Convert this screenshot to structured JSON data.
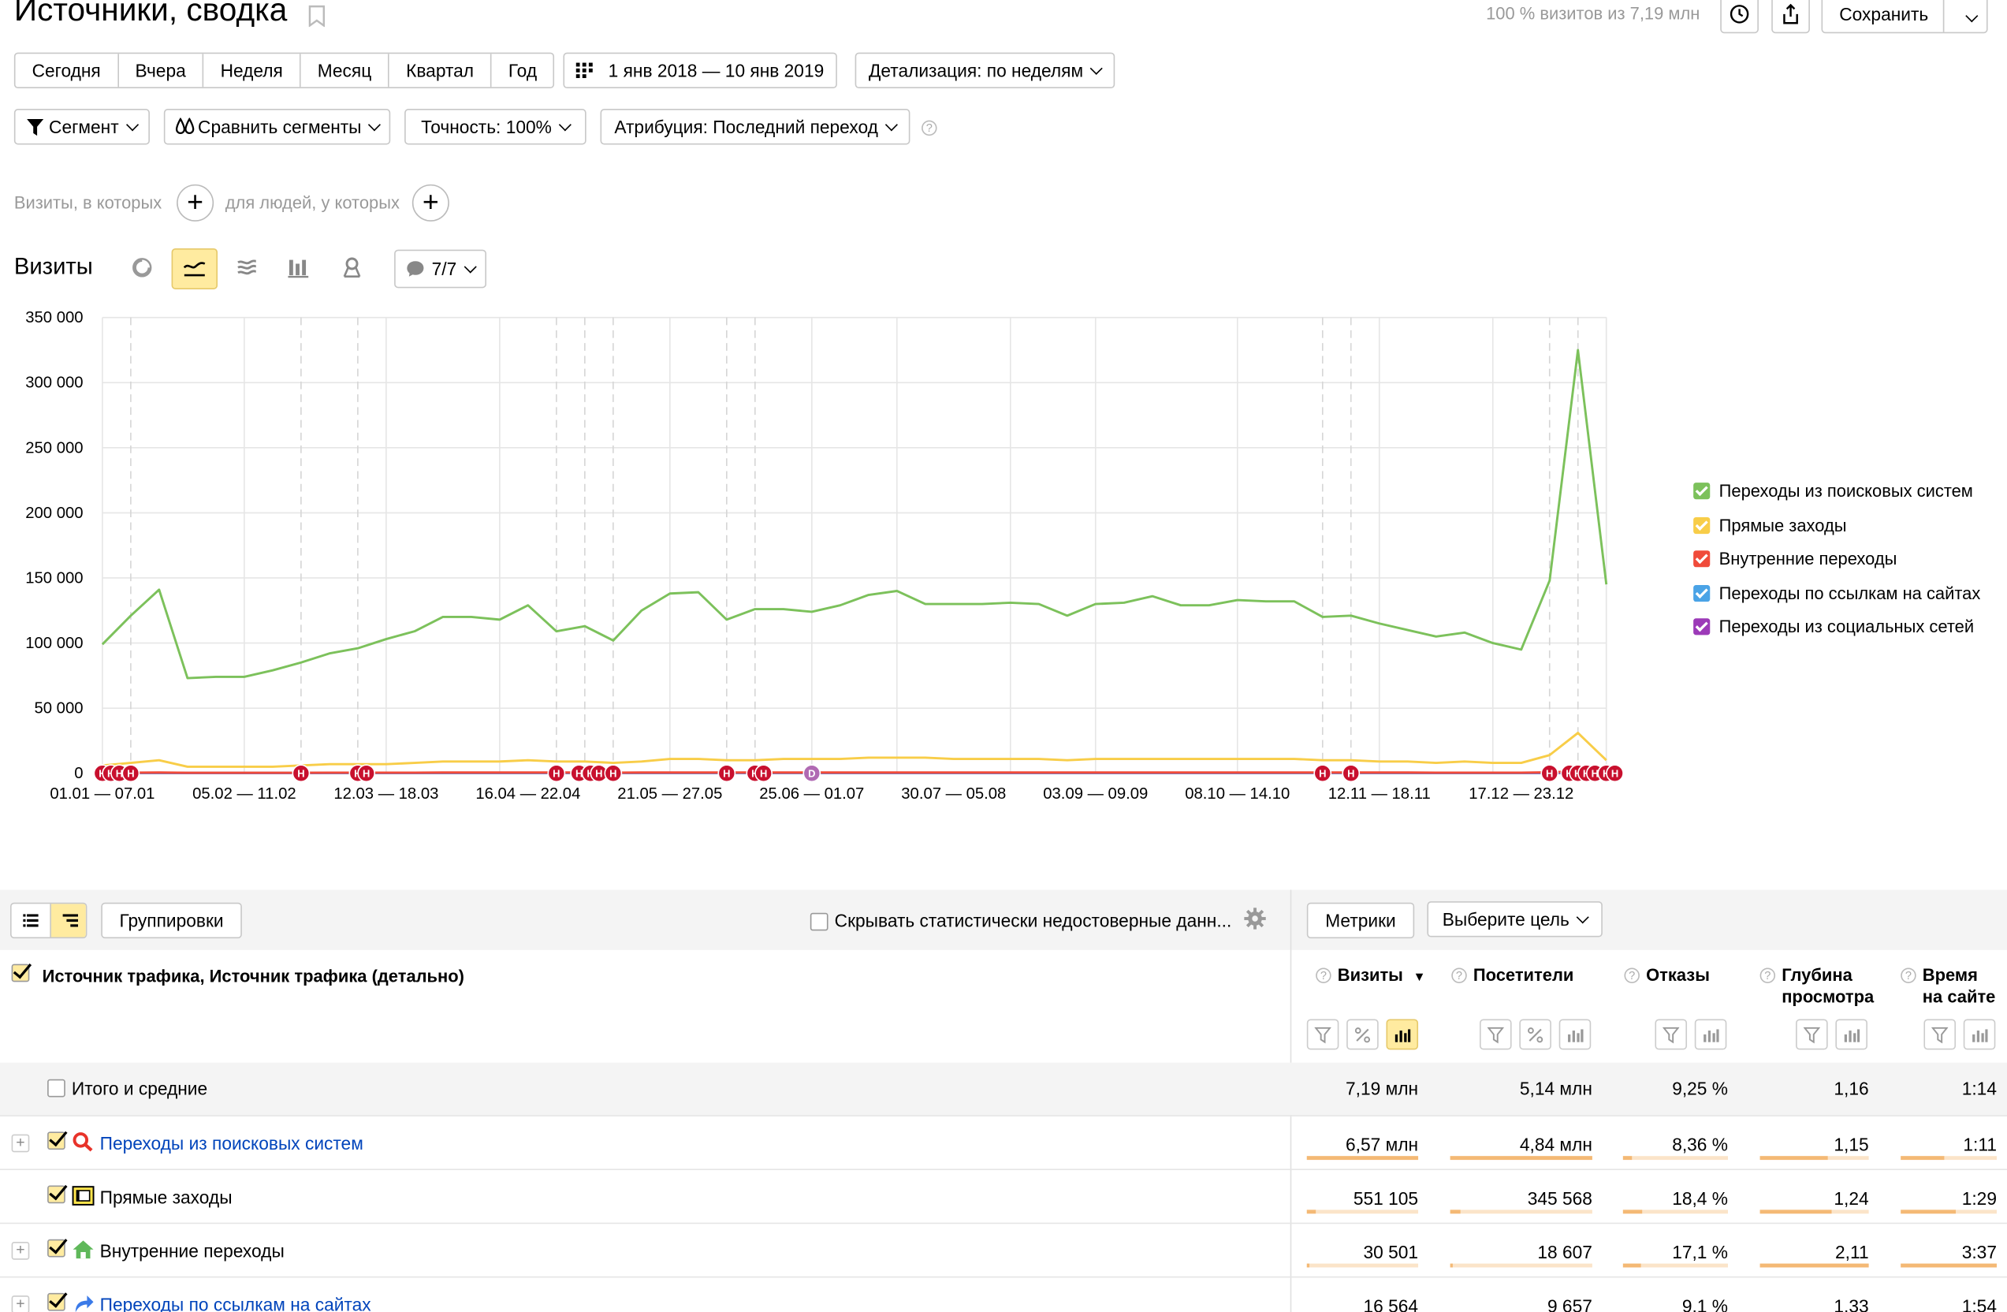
{
  "header": {
    "title": "Источники, сводка",
    "visits_info": "100 % визитов из 7,19 млн",
    "save_label": "Сохранить"
  },
  "periods": [
    "Сегодня",
    "Вчера",
    "Неделя",
    "Месяц",
    "Квартал",
    "Год"
  ],
  "date_range": "1 янв 2018 — 10 янв 2019",
  "detail": "Детализация: по неделям",
  "filters": {
    "segment": "Сегмент",
    "compare": "Сравнить сегменты",
    "accuracy": "Точность: 100%",
    "attribution": "Атрибуция: Последний переход"
  },
  "conditions": {
    "visits_label": "Визиты, в которых",
    "people_label": "для людей, у которых"
  },
  "chart_header": {
    "title": "Визиты",
    "notes_count": "7/7"
  },
  "chart_data": {
    "type": "line",
    "x_tick_labels": [
      "01.01 — 07.01",
      "05.02 — 11.02",
      "12.03 — 18.03",
      "16.04 — 22.04",
      "21.05 — 27.05",
      "25.06 — 01.07",
      "30.07 — 05.08",
      "03.09 — 09.09",
      "08.10 — 14.10",
      "12.11 — 18.11",
      "17.12 — 23.12"
    ],
    "y_tick_labels": [
      "350 000",
      "300 000",
      "250 000",
      "200 000",
      "150 000",
      "100 000",
      "50 000",
      "0"
    ],
    "ylim": [
      0,
      350000
    ],
    "n_weeks": 54,
    "series": [
      {
        "name": "Переходы из поисковых систем",
        "color": "#7cc15b",
        "values": [
          99000,
          121000,
          141000,
          73000,
          74000,
          74000,
          79000,
          85000,
          92000,
          96000,
          103000,
          109000,
          120000,
          120000,
          118000,
          129000,
          109000,
          113000,
          102000,
          125000,
          138000,
          139000,
          118000,
          126000,
          126000,
          124000,
          129000,
          137000,
          140000,
          130000,
          130000,
          130000,
          131000,
          130000,
          121000,
          130000,
          131000,
          136000,
          129000,
          129000,
          133000,
          132000,
          132000,
          120000,
          121000,
          115000,
          110000,
          105000,
          108000,
          100000,
          95000,
          148000,
          325000,
          145000
        ]
      },
      {
        "name": "Прямые заходы",
        "color": "#f8cd48",
        "values": [
          6000,
          8000,
          10000,
          5000,
          5000,
          5000,
          5000,
          6000,
          7000,
          7000,
          7000,
          8000,
          9000,
          9000,
          9000,
          10000,
          9000,
          9000,
          8000,
          9000,
          11000,
          11000,
          10000,
          10000,
          11000,
          11000,
          11000,
          12000,
          12000,
          12000,
          11000,
          11000,
          11000,
          11000,
          10000,
          11000,
          11000,
          11000,
          11000,
          11000,
          11000,
          11000,
          11000,
          10000,
          10000,
          9000,
          9000,
          8000,
          9000,
          8000,
          8000,
          14000,
          31000,
          10000
        ]
      },
      {
        "name": "Внутренние переходы",
        "color": "#f04b3a",
        "values": [
          500,
          500,
          600,
          400,
          400,
          400,
          400,
          400,
          500,
          500,
          500,
          500,
          600,
          600,
          600,
          600,
          600,
          600,
          500,
          600,
          600,
          600,
          600,
          600,
          600,
          600,
          600,
          600,
          600,
          600,
          600,
          600,
          600,
          600,
          600,
          600,
          600,
          600,
          600,
          600,
          600,
          600,
          600,
          600,
          600,
          600,
          600,
          500,
          500,
          500,
          500,
          800,
          1500,
          600
        ]
      },
      {
        "name": "Переходы по ссылкам на сайтах",
        "color": "#4aa3e6",
        "values": [
          300,
          300,
          300,
          300,
          300,
          300,
          300,
          300,
          300,
          300,
          300,
          300,
          300,
          300,
          300,
          300,
          300,
          300,
          300,
          300,
          300,
          300,
          300,
          300,
          300,
          300,
          300,
          300,
          300,
          300,
          300,
          300,
          300,
          300,
          300,
          300,
          300,
          300,
          300,
          300,
          300,
          300,
          300,
          300,
          300,
          300,
          300,
          300,
          300,
          300,
          300,
          400,
          800,
          300
        ]
      },
      {
        "name": "Переходы из социальных сетей",
        "color": "#9c3ab8",
        "values": [
          100,
          100,
          100,
          100,
          100,
          100,
          100,
          100,
          100,
          100,
          100,
          100,
          100,
          100,
          100,
          100,
          100,
          100,
          100,
          100,
          100,
          100,
          100,
          100,
          100,
          100,
          100,
          100,
          100,
          100,
          100,
          100,
          100,
          100,
          100,
          100,
          100,
          100,
          100,
          100,
          100,
          100,
          100,
          100,
          100,
          100,
          100,
          100,
          100,
          100,
          100,
          100,
          200,
          100
        ]
      }
    ],
    "markers": [
      {
        "label": "Н",
        "week": 0.0,
        "color": "#c8102e"
      },
      {
        "label": "Н",
        "week": 0.3,
        "color": "#c8102e"
      },
      {
        "label": "Н",
        "week": 0.6,
        "color": "#c8102e"
      },
      {
        "label": "Н",
        "week": 1.0,
        "color": "#c8102e"
      },
      {
        "label": "Н",
        "week": 7.0,
        "color": "#c8102e"
      },
      {
        "label": "Н",
        "week": 9.0,
        "color": "#c8102e"
      },
      {
        "label": "Н",
        "week": 9.3,
        "color": "#c8102e"
      },
      {
        "label": "Н",
        "week": 16.0,
        "color": "#c8102e"
      },
      {
        "label": "Н",
        "week": 16.8,
        "color": "#c8102e"
      },
      {
        "label": "Н",
        "week": 17.2,
        "color": "#c8102e"
      },
      {
        "label": "Н",
        "week": 17.5,
        "color": "#c8102e"
      },
      {
        "label": "Н",
        "week": 18.0,
        "color": "#c8102e"
      },
      {
        "label": "Н",
        "week": 22.0,
        "color": "#c8102e"
      },
      {
        "label": "Н",
        "week": 23.0,
        "color": "#c8102e"
      },
      {
        "label": "Н",
        "week": 23.3,
        "color": "#c8102e"
      },
      {
        "label": "D",
        "week": 25.0,
        "color": "#b06ab3"
      },
      {
        "label": "Н",
        "week": 43.0,
        "color": "#c8102e"
      },
      {
        "label": "Н",
        "week": 44.0,
        "color": "#c8102e"
      },
      {
        "label": "Н",
        "week": 51.0,
        "color": "#c8102e"
      },
      {
        "label": "Н",
        "week": 51.7,
        "color": "#c8102e"
      },
      {
        "label": "Н",
        "week": 52.0,
        "color": "#c8102e"
      },
      {
        "label": "Н",
        "week": 52.3,
        "color": "#c8102e"
      },
      {
        "label": "Н",
        "week": 52.6,
        "color": "#c8102e"
      },
      {
        "label": "Н",
        "week": 53.0,
        "color": "#c8102e"
      },
      {
        "label": "Н",
        "week": 53.3,
        "color": "#c8102e"
      }
    ],
    "vlines_dashed": [
      1,
      7,
      9,
      16,
      17,
      18,
      22,
      23,
      43,
      44,
      51,
      52
    ],
    "vlines_solid": [
      0,
      5,
      10,
      14,
      20,
      25,
      28,
      32,
      35,
      40,
      45,
      49,
      53
    ],
    "grid": true,
    "legend_position": "right"
  },
  "table_toolbar": {
    "groupings": "Группировки",
    "hide_label": "Скрывать статистически недостоверные данн...",
    "metrics": "Метрики",
    "goal": "Выберите цель"
  },
  "table": {
    "dimension_header": "Источник трафика, Источник трафика (детально)",
    "columns": [
      {
        "label1": "Визиты",
        "label2": "",
        "sort": "▼"
      },
      {
        "label1": "Посетители",
        "label2": ""
      },
      {
        "label1": "Отказы",
        "label2": ""
      },
      {
        "label1": "Глубина",
        "label2": "просмотра"
      },
      {
        "label1": "Время",
        "label2": "на сайте"
      }
    ],
    "totals": {
      "label": "Итого и средние",
      "values": [
        "7,19 млн",
        "5,14 млн",
        "9,25 %",
        "1,16",
        "1:14"
      ]
    },
    "rows": [
      {
        "label": "Переходы из поисковых систем",
        "link": true,
        "icon": "search-icon",
        "values": [
          "6,57 млн",
          "4,84 млн",
          "8,36 %",
          "1,15",
          "1:11"
        ],
        "fills": [
          1.0,
          1.0,
          0.08,
          0.62,
          0.45
        ]
      },
      {
        "label": "Прямые заходы",
        "link": false,
        "icon": "direct-icon",
        "values": [
          "551 105",
          "345 568",
          "18,4 %",
          "1,24",
          "1:29"
        ],
        "fills": [
          0.08,
          0.07,
          0.18,
          0.66,
          0.57
        ]
      },
      {
        "label": "Внутренние переходы",
        "link": false,
        "icon": "home-icon",
        "values": [
          "30 501",
          "18 607",
          "17,1 %",
          "2,11",
          "3:37"
        ],
        "fills": [
          0.01,
          0.01,
          0.17,
          1.0,
          1.0
        ]
      },
      {
        "label": "Переходы по ссылкам на сайтах",
        "link": true,
        "icon": "link-arrow-icon",
        "values": [
          "16 564",
          "9 657",
          "9,1 %",
          "1,33",
          "1:54"
        ],
        "fills": [
          0.01,
          0.01,
          0.09,
          0.63,
          0.53
        ]
      }
    ]
  }
}
